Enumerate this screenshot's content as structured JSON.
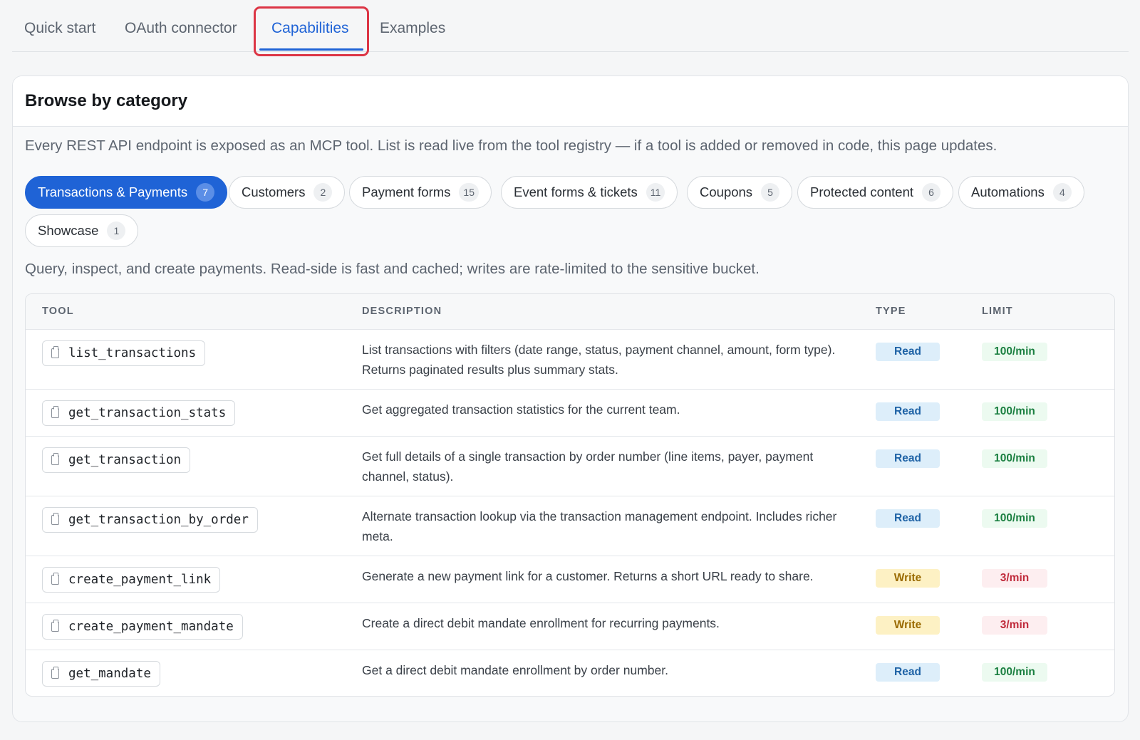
{
  "tabs": [
    {
      "label": "Quick start"
    },
    {
      "label": "OAuth connector"
    },
    {
      "label": "Capabilities",
      "active": true
    },
    {
      "label": "Examples"
    }
  ],
  "card": {
    "title": "Browse by category",
    "intro": "Every REST API endpoint is exposed as an MCP tool. List is read live from the tool registry — if a tool is added or removed in code, this page updates."
  },
  "categories": [
    {
      "label": "Transactions & Payments",
      "count": "7",
      "active": true
    },
    {
      "label": "Customers",
      "count": "2"
    },
    {
      "label": "Payment forms",
      "count": "15"
    },
    {
      "label": "Event forms & tickets",
      "count": "11"
    },
    {
      "label": "Coupons",
      "count": "5"
    },
    {
      "label": "Protected content",
      "count": "6"
    },
    {
      "label": "Automations",
      "count": "4"
    },
    {
      "label": "Showcase",
      "count": "1"
    }
  ],
  "category_description": "Query, inspect, and create payments. Read-side is fast and cached; writes are rate-limited to the sensitive bucket.",
  "table": {
    "headers": {
      "tool": "TOOL",
      "description": "DESCRIPTION",
      "type": "TYPE",
      "limit": "LIMIT"
    },
    "rows": [
      {
        "tool": "list_transactions",
        "description": "List transactions with filters (date range, status, payment channel, amount, form type). Returns paginated results plus summary stats.",
        "type": "Read",
        "limit": "100/min"
      },
      {
        "tool": "get_transaction_stats",
        "description": "Get aggregated transaction statistics for the current team.",
        "type": "Read",
        "limit": "100/min"
      },
      {
        "tool": "get_transaction",
        "description": "Get full details of a single transaction by order number (line items, payer, payment channel, status).",
        "type": "Read",
        "limit": "100/min"
      },
      {
        "tool": "get_transaction_by_order",
        "description": "Alternate transaction lookup via the transaction management endpoint. Includes richer meta.",
        "type": "Read",
        "limit": "100/min"
      },
      {
        "tool": "create_payment_link",
        "description": "Generate a new payment link for a customer. Returns a short URL ready to share.",
        "type": "Write",
        "limit": "3/min"
      },
      {
        "tool": "create_payment_mandate",
        "description": "Create a direct debit mandate enrollment for recurring payments.",
        "type": "Write",
        "limit": "3/min"
      },
      {
        "tool": "get_mandate",
        "description": "Get a direct debit mandate enrollment by order number.",
        "type": "Read",
        "limit": "100/min"
      }
    ]
  },
  "colors": {
    "accent": "#1f63d6",
    "highlight": "#dc3545",
    "read_bg": "#ddeefa",
    "write_bg": "#fdf1c4",
    "limit_ok": "#1a7f40",
    "limit_strict": "#c02a3b"
  },
  "icons": {
    "copy": "clipboard-icon"
  }
}
